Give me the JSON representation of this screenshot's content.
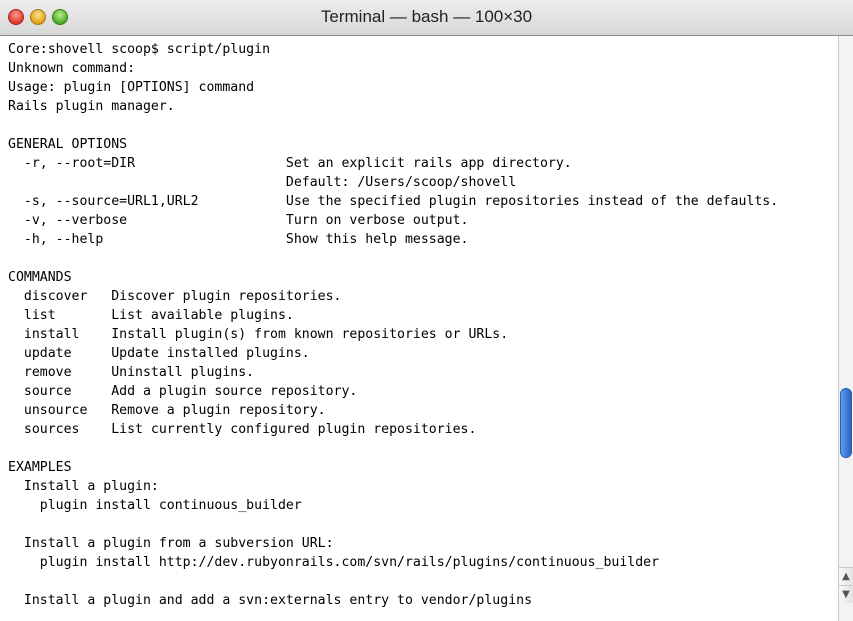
{
  "window": {
    "title": "Terminal — bash — 100×30"
  },
  "terminal": {
    "lines": [
      "Core:shovell scoop$ script/plugin",
      "Unknown command:",
      "Usage: plugin [OPTIONS] command",
      "Rails plugin manager.",
      "",
      "GENERAL OPTIONS",
      "  -r, --root=DIR                   Set an explicit rails app directory.",
      "                                   Default: /Users/scoop/shovell",
      "  -s, --source=URL1,URL2           Use the specified plugin repositories instead of the defaults.",
      "  -v, --verbose                    Turn on verbose output.",
      "  -h, --help                       Show this help message.",
      "",
      "COMMANDS",
      "  discover   Discover plugin repositories.",
      "  list       List available plugins.",
      "  install    Install plugin(s) from known repositories or URLs.",
      "  update     Update installed plugins.",
      "  remove     Uninstall plugins.",
      "  source     Add a plugin source repository.",
      "  unsource   Remove a plugin repository.",
      "  sources    List currently configured plugin repositories.",
      "",
      "EXAMPLES",
      "  Install a plugin:",
      "    plugin install continuous_builder",
      "",
      "  Install a plugin from a subversion URL:",
      "    plugin install http://dev.rubyonrails.com/svn/rails/plugins/continuous_builder",
      "",
      "  Install a plugin and add a svn:externals entry to vendor/plugins"
    ]
  }
}
